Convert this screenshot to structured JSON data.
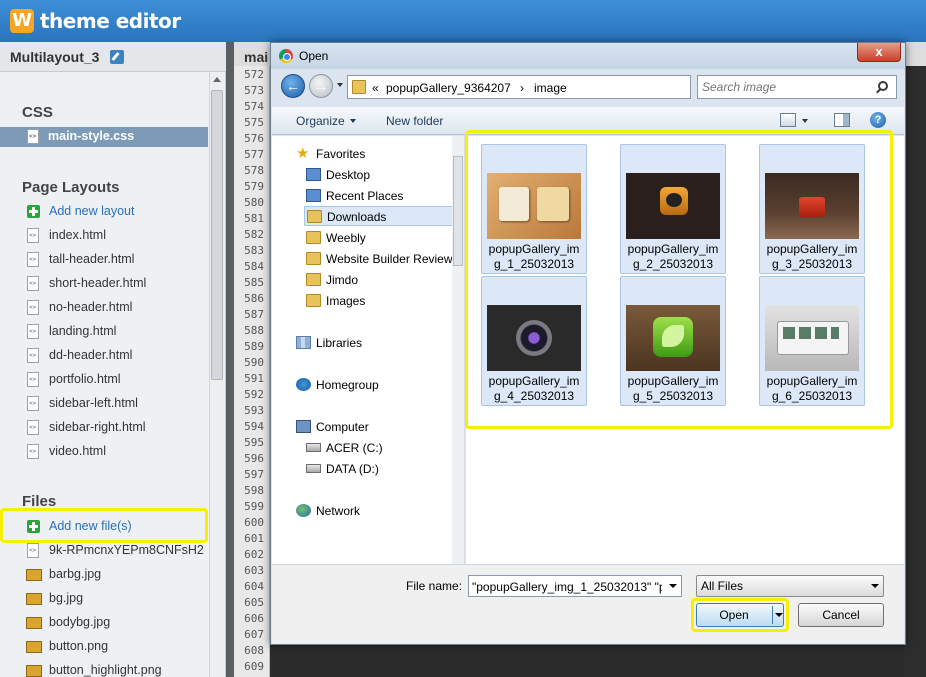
{
  "app": {
    "logo_letter": "W",
    "logo_text": "theme editor"
  },
  "sidebar": {
    "project_name": "Multilayout_3",
    "css_title": "CSS",
    "css_files": [
      "main-style.css"
    ],
    "layouts_title": "Page Layouts",
    "add_layout_label": "Add new layout",
    "layouts": [
      "index.html",
      "tall-header.html",
      "short-header.html",
      "no-header.html",
      "landing.html",
      "dd-header.html",
      "portfolio.html",
      "sidebar-left.html",
      "sidebar-right.html",
      "video.html"
    ],
    "files_title": "Files",
    "add_file_label": "Add new file(s)",
    "files": [
      "9k-RPmcnxYEPm8CNFsH2",
      "barbg.jpg",
      "bg.jpg",
      "bodybg.jpg",
      "button.png",
      "button_highlight.png"
    ]
  },
  "editor": {
    "tab_label": "mai",
    "line_numbers": [
      "572",
      "573",
      "574",
      "575",
      "576",
      "577",
      "578",
      "579",
      "580",
      "581",
      "582",
      "583",
      "584",
      "585",
      "586",
      "587",
      "588",
      "589",
      "590",
      "591",
      "592",
      "593",
      "594",
      "595",
      "596",
      "597",
      "598",
      "599",
      "600",
      "601",
      "602",
      "603",
      "604",
      "605",
      "606",
      "607",
      "608",
      "609"
    ]
  },
  "dialog": {
    "title": "Open",
    "close_label": "x",
    "breadcrumb": {
      "prefix": "«",
      "folder": "popupGallery_9364207",
      "separator": "›",
      "subfolder": "image"
    },
    "search_placeholder": "Search image",
    "toolbar": {
      "organize_label": "Organize",
      "new_folder_label": "New folder",
      "help_label": "?"
    },
    "nav": {
      "favorites_label": "Favorites",
      "favorites": [
        "Desktop",
        "Recent Places",
        "Downloads",
        "Weebly",
        "Website Builder Review",
        "Jimdo",
        "Images"
      ],
      "libraries_label": "Libraries",
      "homegroup_label": "Homegroup",
      "computer_label": "Computer",
      "drives": [
        "ACER (C:)",
        "DATA (D:)"
      ],
      "network_label": "Network"
    },
    "files": [
      {
        "line1": "popupGallery_im",
        "line2": "g_1_25032013"
      },
      {
        "line1": "popupGallery_im",
        "line2": "g_2_25032013"
      },
      {
        "line1": "popupGallery_im",
        "line2": "g_3_25032013"
      },
      {
        "line1": "popupGallery_im",
        "line2": "g_4_25032013"
      },
      {
        "line1": "popupGallery_im",
        "line2": "g_5_25032013"
      },
      {
        "line1": "popupGallery_im",
        "line2": "g_6_25032013"
      }
    ],
    "file_name_label": "File name:",
    "file_name_value": "\"popupGallery_img_1_25032013\" \"po",
    "file_type_value": "All Files",
    "open_label": "Open",
    "cancel_label": "Cancel"
  },
  "colors": {
    "header_blue": "#2a74bd",
    "highlight_yellow": "#f5f000",
    "selection_blue": "#dce8f7"
  }
}
